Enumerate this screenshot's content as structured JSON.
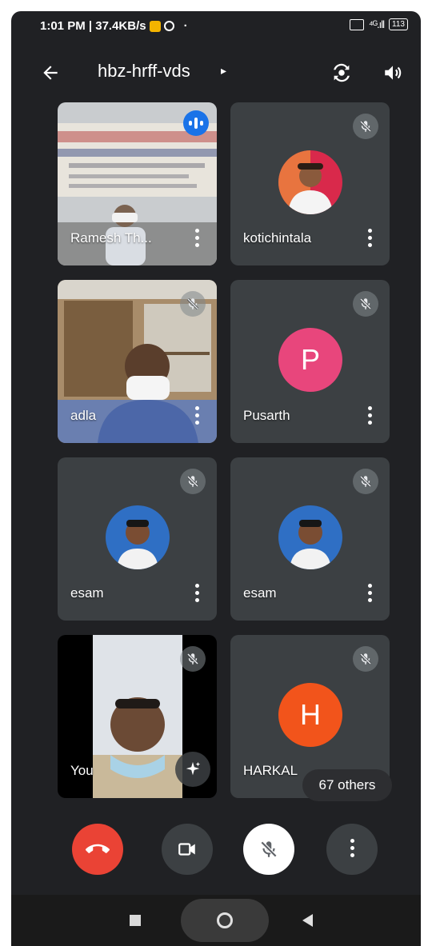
{
  "status_bar": {
    "time_speed": "1:01 PM | 37.4KB/s",
    "dot": "·",
    "signal": "⁴ᴳ.ıll",
    "battery": "113"
  },
  "meeting": {
    "code": "hbz-hrff-vds",
    "caret": "▸"
  },
  "tiles": [
    {
      "name": "Ramesh Th...",
      "video": "slide-banner",
      "state": "speaking"
    },
    {
      "name": "kotichintala",
      "avatar": "photo-red-bg",
      "state": "muted"
    },
    {
      "name": "adla",
      "video": "office-shelves",
      "state": "muted"
    },
    {
      "name": "Pusarth",
      "avatar_letter": "P",
      "avatar_color": "#e8467c",
      "state": "muted"
    },
    {
      "name": "esam",
      "avatar": "photo-blue-bg",
      "state": "muted"
    },
    {
      "name": "esam",
      "avatar": "photo-blue-bg",
      "state": "muted"
    },
    {
      "name": "You",
      "video": "self-view",
      "state": "muted"
    },
    {
      "name": "HARKAL",
      "avatar_letter": "H",
      "avatar_color": "#f2541b",
      "state": "muted"
    }
  ],
  "others_label": "67 others",
  "controls": {
    "end_call_color": "#ea4335",
    "icons": [
      "end-call-icon",
      "camera-icon",
      "mic-off-icon",
      "more-vert-icon"
    ]
  },
  "colors": {
    "background": "#202124",
    "tile": "#3c4043",
    "speaking": "#1a73e8"
  }
}
